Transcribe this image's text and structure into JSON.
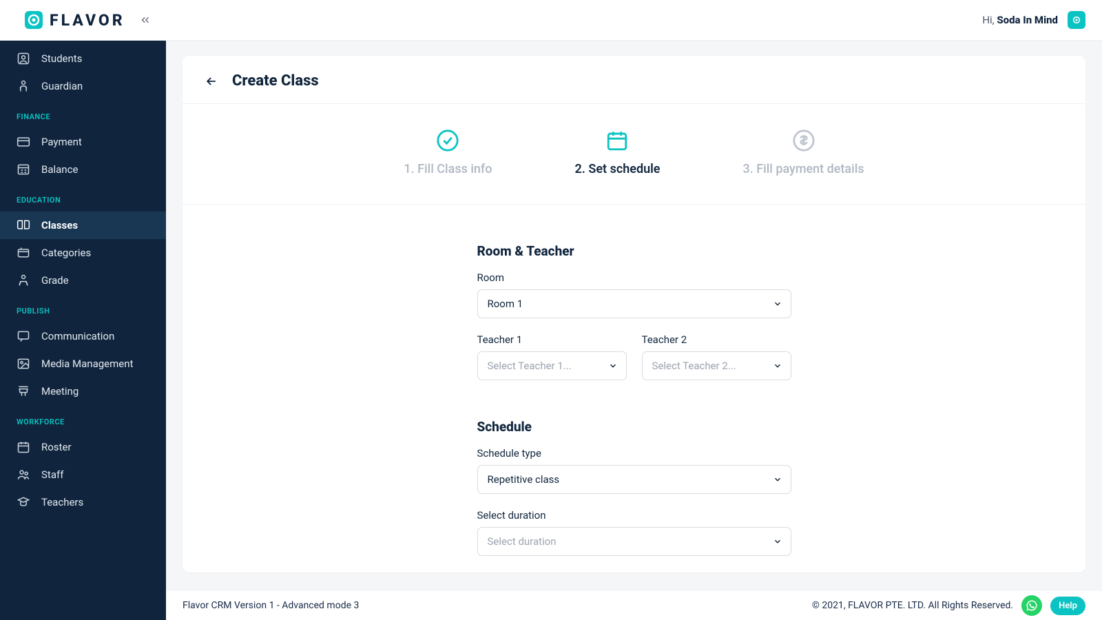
{
  "brand": {
    "name": "FLAVOR"
  },
  "header": {
    "greeting_prefix": "Hi, ",
    "username": "Soda In Mind"
  },
  "sidebar": {
    "top_items": [
      {
        "label": "Students",
        "icon": "user-box-icon"
      },
      {
        "label": "Guardian",
        "icon": "guardian-icon"
      }
    ],
    "sections": [
      {
        "title": "FINANCE",
        "items": [
          {
            "label": "Payment",
            "icon": "card-icon"
          },
          {
            "label": "Balance",
            "icon": "ledger-icon"
          }
        ]
      },
      {
        "title": "EDUCATION",
        "items": [
          {
            "label": "Classes",
            "icon": "book-icon",
            "active": true
          },
          {
            "label": "Categories",
            "icon": "folder-icon"
          },
          {
            "label": "Grade",
            "icon": "grade-icon"
          }
        ]
      },
      {
        "title": "PUBLISH",
        "items": [
          {
            "label": "Communication",
            "icon": "chat-icon"
          },
          {
            "label": "Media Management",
            "icon": "image-icon"
          },
          {
            "label": "Meeting",
            "icon": "podium-icon"
          }
        ]
      },
      {
        "title": "WORKFORCE",
        "items": [
          {
            "label": "Roster",
            "icon": "calendar-icon"
          },
          {
            "label": "Staff",
            "icon": "people-icon"
          },
          {
            "label": "Teachers",
            "icon": "teacher-icon"
          }
        ]
      }
    ]
  },
  "page": {
    "title": "Create Class",
    "steps": [
      {
        "label": "1. Fill Class info",
        "state": "completed"
      },
      {
        "label": "2. Set schedule",
        "state": "active"
      },
      {
        "label": "3. Fill payment details",
        "state": "inactive"
      }
    ],
    "form": {
      "section1_title": "Room & Teacher",
      "room_label": "Room",
      "room_value": "Room 1",
      "teacher1_label": "Teacher 1",
      "teacher1_placeholder": "Select Teacher 1...",
      "teacher2_label": "Teacher 2",
      "teacher2_placeholder": "Select Teacher 2...",
      "section2_title": "Schedule",
      "schedule_type_label": "Schedule type",
      "schedule_type_value": "Repetitive class",
      "duration_label": "Select duration",
      "duration_placeholder": "Select duration"
    }
  },
  "footer": {
    "left": "Flavor CRM Version 1 - Advanced mode 3",
    "right": "© 2021, FLAVOR PTE. LTD. All Rights Reserved.",
    "help_label": "Help"
  }
}
